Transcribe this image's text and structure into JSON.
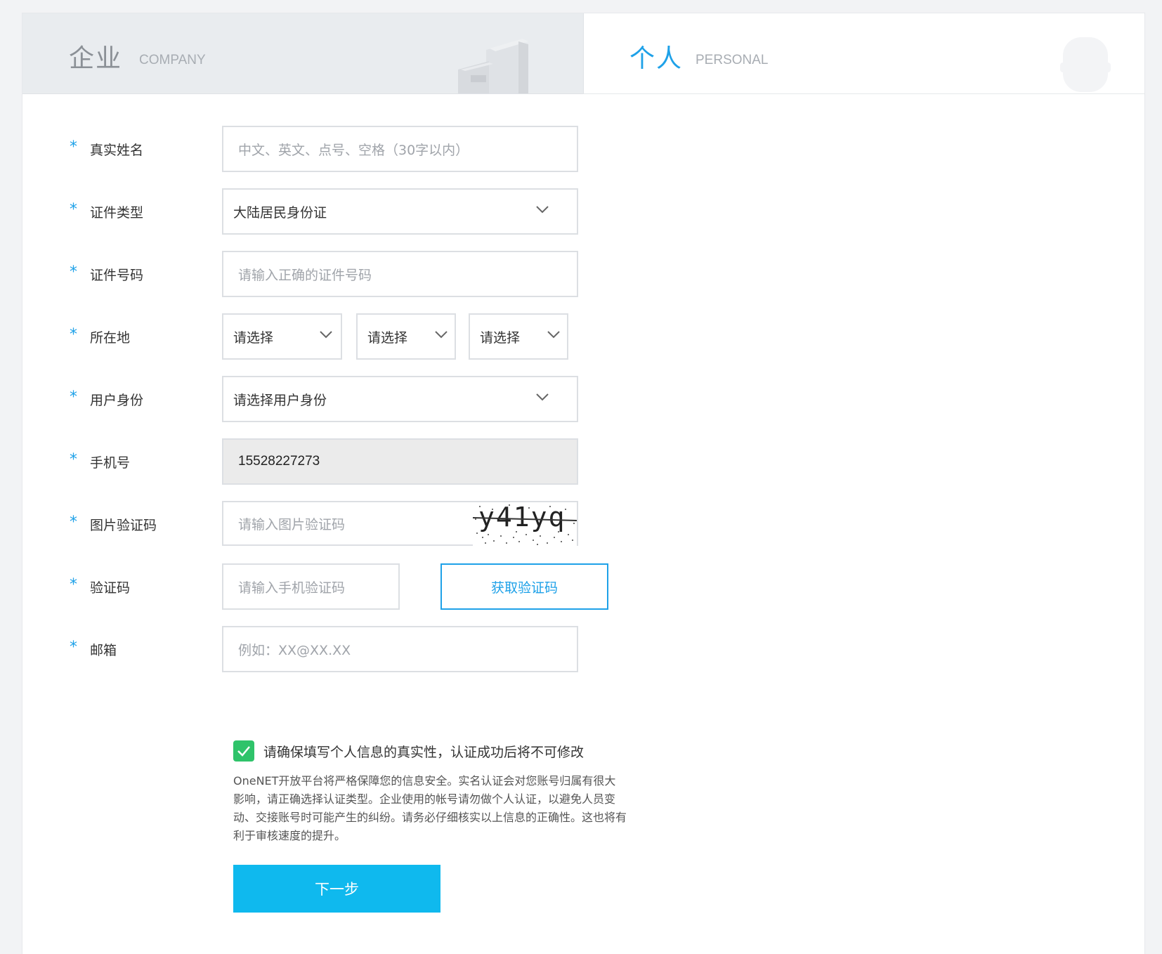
{
  "tabs": {
    "company": {
      "cn": "企业",
      "en": "COMPANY"
    },
    "personal": {
      "cn": "个人",
      "en": "PERSONAL"
    }
  },
  "form": {
    "required_mark": "*",
    "real_name": {
      "label": "真实姓名",
      "placeholder": "中文、英文、点号、空格（30字以内）"
    },
    "id_type": {
      "label": "证件类型",
      "value": "大陆居民身份证"
    },
    "id_number": {
      "label": "证件号码",
      "placeholder": "请输入正确的证件号码"
    },
    "location": {
      "label": "所在地",
      "province": "请选择",
      "city": "请选择",
      "district": "请选择"
    },
    "user_identity": {
      "label": "用户身份",
      "value": "请选择用户身份"
    },
    "phone": {
      "label": "手机号",
      "value": "15528227273"
    },
    "captcha": {
      "label": "图片验证码",
      "placeholder": "请输入图片验证码",
      "image_text": "y41yq"
    },
    "sms_code": {
      "label": "验证码",
      "placeholder": "请输入手机验证码",
      "button": "获取验证码"
    },
    "email": {
      "label": "邮箱",
      "placeholder": "例如：XX@XX.XX"
    }
  },
  "agreement": {
    "checked": true,
    "text": "请确保填写个人信息的真实性，认证成功后将不可修改"
  },
  "notice": "OneNET开放平台将严格保障您的信息安全。实名认证会对您账号归属有很大影响，请正确选择认证类型。企业使用的帐号请勿做个人认证，以避免人员变动、交接账号时可能产生的纠纷。请务必仔细核实以上信息的正确性。这也将有利于审核速度的提升。",
  "next_button": "下一步",
  "colors": {
    "accent": "#1ea1e8",
    "button": "#0fb9ee",
    "checkbox": "#2fc36a"
  }
}
